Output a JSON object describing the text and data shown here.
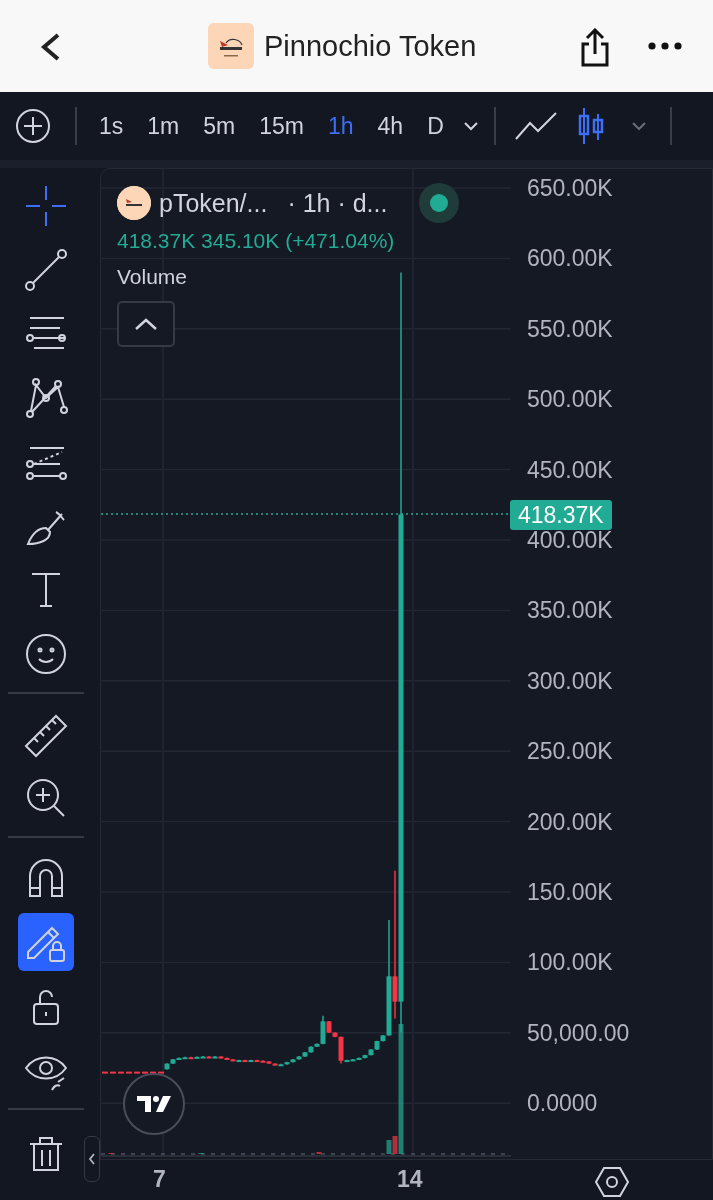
{
  "header": {
    "title": "Pinnochio Token"
  },
  "toolbar": {
    "intervals": [
      {
        "label": "1s",
        "selected": false
      },
      {
        "label": "1m",
        "selected": false
      },
      {
        "label": "5m",
        "selected": false
      },
      {
        "label": "15m",
        "selected": false
      },
      {
        "label": "1h",
        "selected": true
      },
      {
        "label": "4h",
        "selected": false
      },
      {
        "label": "D",
        "selected": false
      }
    ],
    "chart_types": [
      {
        "kind": "line",
        "selected": false
      },
      {
        "kind": "candles",
        "selected": true
      }
    ]
  },
  "tool_groups": [
    {
      "tools": [
        {
          "kind": "crosshair",
          "selected": true,
          "on": false
        },
        {
          "kind": "trendline",
          "selected": false,
          "on": false
        },
        {
          "kind": "levels",
          "selected": false,
          "on": false
        },
        {
          "kind": "pattern",
          "selected": false,
          "on": false
        },
        {
          "kind": "projection",
          "selected": false,
          "on": false
        },
        {
          "kind": "brush",
          "selected": false,
          "on": false
        },
        {
          "kind": "text",
          "selected": false,
          "on": false
        },
        {
          "kind": "emoji",
          "selected": false,
          "on": false
        }
      ]
    },
    {
      "tools": [
        {
          "kind": "ruler",
          "selected": false,
          "on": false
        },
        {
          "kind": "zoom",
          "selected": false,
          "on": false
        }
      ]
    },
    {
      "tools": [
        {
          "kind": "magnet",
          "selected": false,
          "on": false
        },
        {
          "kind": "drawlock",
          "selected": false,
          "on": true
        },
        {
          "kind": "lock",
          "selected": false,
          "on": false
        },
        {
          "kind": "eye",
          "selected": false,
          "on": false
        }
      ]
    },
    {
      "tools": [
        {
          "kind": "trash",
          "selected": false,
          "on": false
        }
      ]
    }
  ],
  "legend": {
    "symbol": "pToken/...",
    "details": "· 1h · d...",
    "live": true,
    "values": "418.37K 345.10K (+471.04%)",
    "volume_label": "Volume"
  },
  "price_axis": {
    "labels": [
      "650.00K",
      "600.00K",
      "550.00K",
      "500.00K",
      "450.00K",
      "400.00K",
      "350.00K",
      "300.00K",
      "250.00K",
      "200.00K",
      "150.00K",
      "100.00K",
      "50,000.00",
      "0.0000"
    ],
    "last_price": "418.37K"
  },
  "time_axis": {
    "labels": [
      "7",
      "14"
    ]
  }
}
